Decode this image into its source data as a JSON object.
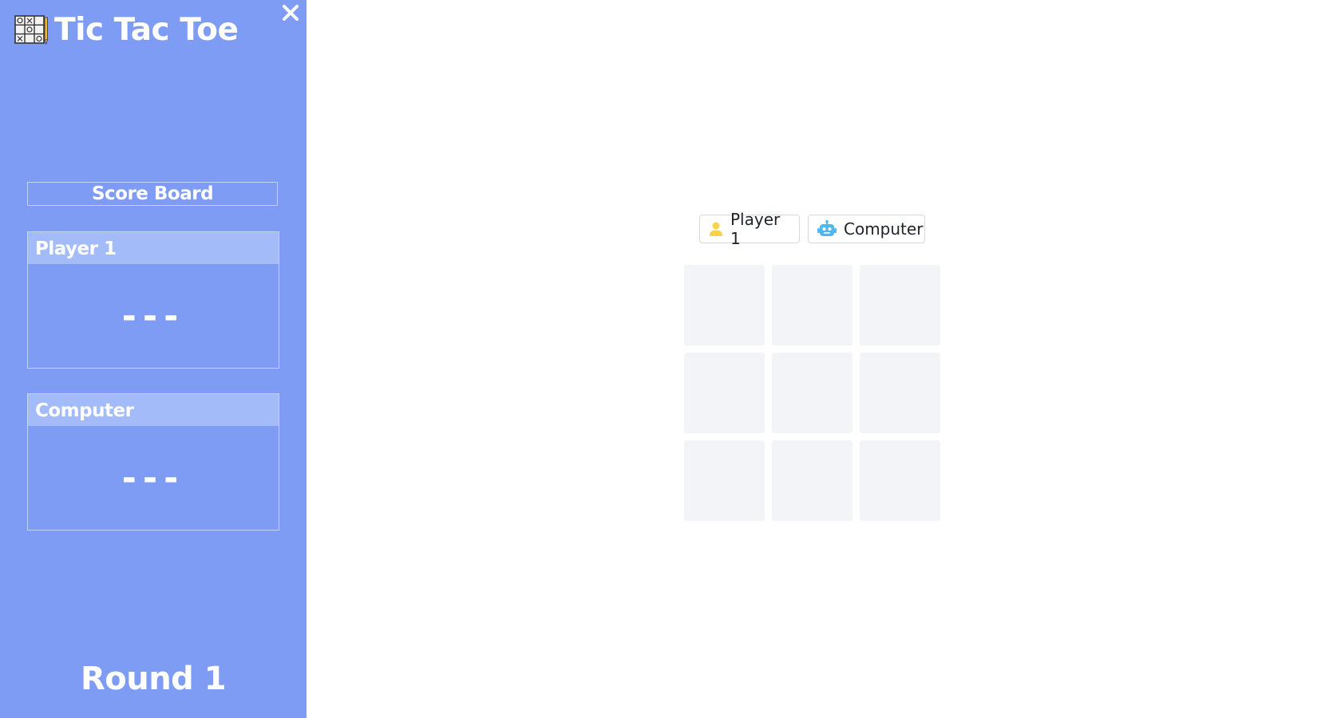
{
  "app": {
    "title": "Tic Tac Toe"
  },
  "icons": {
    "brand": "tic-tac-toe-grid-icon",
    "close": "close-icon",
    "player": "user-icon",
    "computer": "robot-icon"
  },
  "colors": {
    "sidebar": "#7f9cf5",
    "card_header": "#a3bbf9",
    "cell": "#f2f4f7",
    "player_icon": "#f8d24a",
    "computer_icon": "#4fb8f0"
  },
  "scoreboard": {
    "title": "Score Board",
    "players": [
      {
        "name": "Player 1",
        "score": "---"
      },
      {
        "name": "Computer",
        "score": "---"
      }
    ]
  },
  "round_label": "Round 1",
  "turn_selector": {
    "player_label": "Player 1",
    "computer_label": "Computer"
  },
  "board": {
    "cells": [
      "",
      "",
      "",
      "",
      "",
      "",
      "",
      "",
      ""
    ]
  }
}
